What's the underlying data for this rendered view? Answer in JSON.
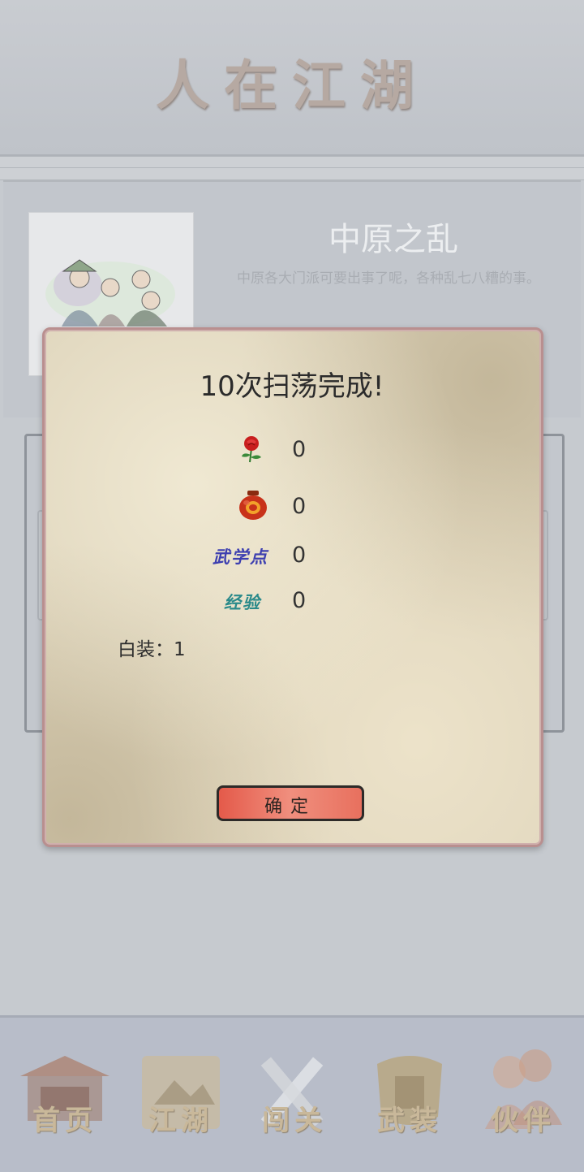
{
  "app": {
    "title": "人在江湖"
  },
  "chapter": {
    "title": "中原之乱",
    "description": "中原各大门派可要出事了呢，各种乱七八糟的事。"
  },
  "nav": {
    "items": [
      {
        "label": "首页",
        "icon": "house-icon"
      },
      {
        "label": "江湖",
        "icon": "scroll-map-icon"
      },
      {
        "label": "闯关",
        "icon": "crossed-swords-icon"
      },
      {
        "label": "武装",
        "icon": "armor-icon"
      },
      {
        "label": "伙伴",
        "icon": "companions-icon"
      }
    ]
  },
  "dialog": {
    "title": "10次扫荡完成!",
    "rewards": [
      {
        "icon": "rose-icon",
        "value": "0"
      },
      {
        "icon": "wine-jar-icon",
        "value": "0"
      },
      {
        "label": "武学点",
        "value": "0",
        "color": "#3d3fb0"
      },
      {
        "label": "经验",
        "value": "0",
        "color": "#2a8a8a"
      }
    ],
    "equipment": "白装：1",
    "confirm_label": "确定"
  }
}
